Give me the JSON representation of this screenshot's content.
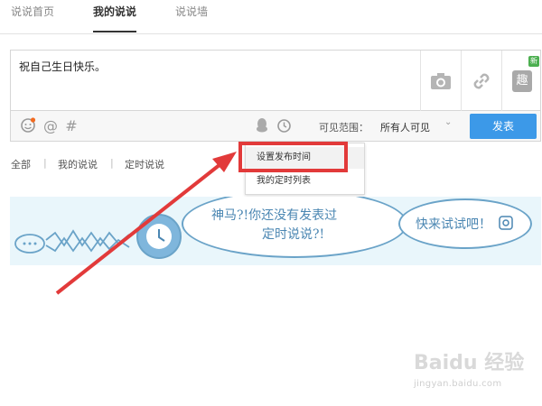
{
  "tabs": [
    {
      "label": "说说首页",
      "active": false
    },
    {
      "label": "我的说说",
      "active": true
    },
    {
      "label": "说说墙",
      "active": false
    }
  ],
  "composer": {
    "text": "祝自己生日快乐。",
    "side_buttons": [
      "camera-icon",
      "link-icon",
      "fun-icon"
    ],
    "fun_badge": "新",
    "fun_label": "趣"
  },
  "toolbar": {
    "icons": [
      "emoji-icon",
      "at-icon",
      "hashtag-icon",
      "qq-penguin-icon",
      "clock-icon"
    ],
    "visibility_label": "可见范围：",
    "visibility_value": "所有人可见",
    "publish_label": "发表"
  },
  "filters": {
    "all": "全部",
    "mine": "我的说说",
    "scheduled": "定时说说",
    "separator": "|"
  },
  "dropdown": {
    "items": [
      "设置发布时间",
      "我的定时列表"
    ],
    "highlighted_index": 0
  },
  "banner": {
    "bubble1": "神马?!你还没有发表过",
    "bubble1_line2": "定时说说?!",
    "bubble2": "快来试试吧！"
  },
  "watermark": {
    "logo": "Baidu 经验",
    "url": "jingyan.baidu.com"
  },
  "colors": {
    "accent": "#3c99e8",
    "highlight": "#e23a3a",
    "banner_bg": "#e9f6fb"
  }
}
